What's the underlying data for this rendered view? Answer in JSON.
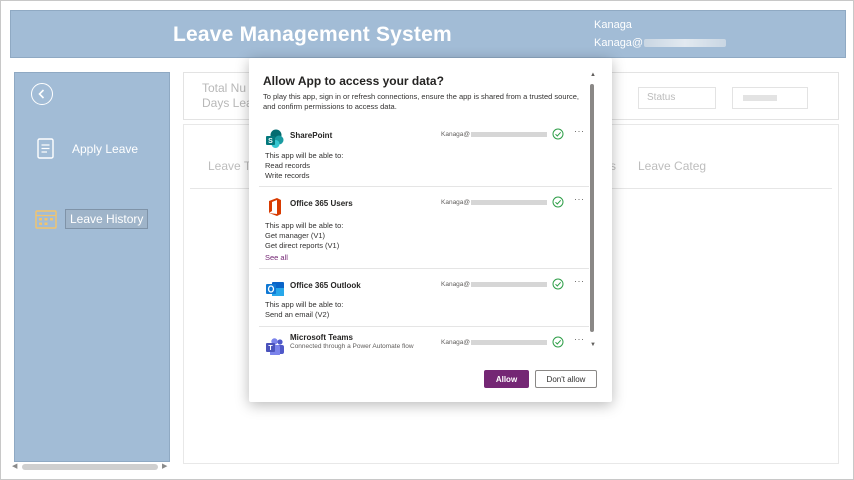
{
  "header": {
    "title": "Leave Management System",
    "user_name": "Kanaga",
    "user_email_prefix": "Kanaga@"
  },
  "sidebar": {
    "items": [
      {
        "label": "Apply Leave",
        "icon": "document-icon"
      },
      {
        "label": "Leave History",
        "icon": "calendar-icon"
      }
    ]
  },
  "main": {
    "total_label_1": "Total Nu",
    "total_label_2": "Days Leav",
    "status_placeholder": "Status",
    "col_leave_type": "Leave Ty",
    "col_s": "s",
    "col_leave_category": "Leave Categ"
  },
  "dialog": {
    "title": "Allow App to access your data?",
    "description": "To play this app, sign in or refresh connections, ensure the app is shared from a trusted source, and confirm permissions to access data.",
    "connections": [
      {
        "name": "SharePoint",
        "account": "Kanaga@",
        "icon": "sharepoint-icon",
        "permission_heading": "This app will be able to:",
        "permissions": [
          "Read records",
          "Write records"
        ]
      },
      {
        "name": "Office 365 Users",
        "account": "Kanaga@",
        "icon": "office365-icon",
        "permission_heading": "This app will be able to:",
        "permissions": [
          "Get manager (V1)",
          "Get direct reports (V1)"
        ],
        "see_all": "See all"
      },
      {
        "name": "Office 365 Outlook",
        "account": "Kanaga@",
        "icon": "outlook-icon",
        "permission_heading": "This app will be able to:",
        "permissions": [
          "Send an email (V2)"
        ]
      },
      {
        "name": "Microsoft Teams",
        "account": "Kanaga@",
        "icon": "teams-icon",
        "subtitle": "Connected through a Power Automate flow"
      }
    ],
    "allow_label": "Allow",
    "deny_label": "Don't allow",
    "more_label": "···"
  },
  "colors": {
    "header_bg": "#a2bcd6",
    "accent": "#742774",
    "check": "#2e9e48"
  }
}
